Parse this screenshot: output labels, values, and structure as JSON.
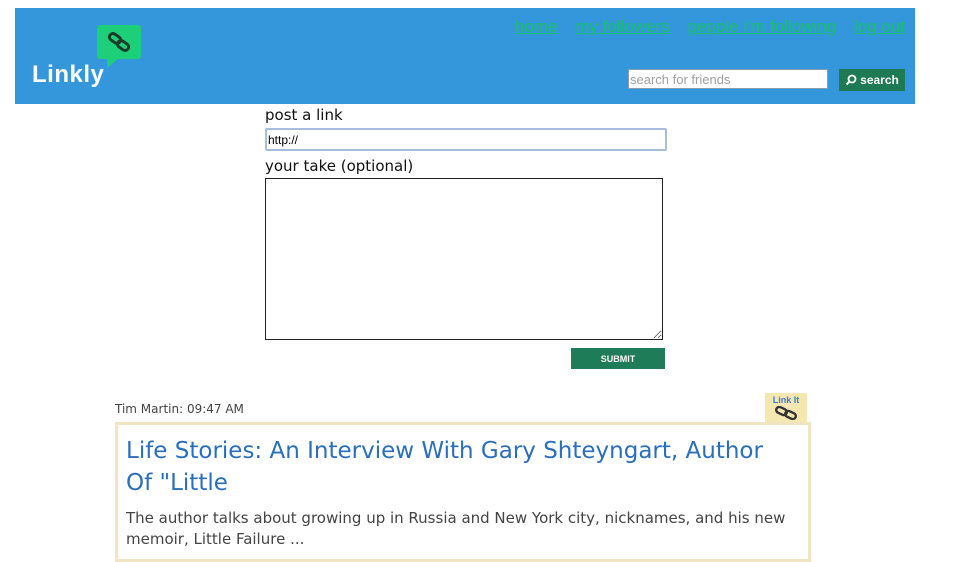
{
  "header": {
    "logo_text": "Linkly",
    "nav": {
      "home": "home",
      "followers": "my followers",
      "following": "people I'm following",
      "logout": "log out"
    },
    "search": {
      "placeholder": "search for friends",
      "button_label": "search"
    },
    "colors": {
      "bar": "#3497db",
      "accent": "#1ecf7a",
      "nav_link": "#17c06a"
    }
  },
  "post_form": {
    "link_label": "post a link",
    "link_value": "http://",
    "take_label": "your take (optional)",
    "take_value": "",
    "submit_label": "SUBMIT"
  },
  "feed": [
    {
      "meta": "Tim Martin: 09:47 AM",
      "link_it_label": "Link It",
      "title": "Life Stories: An Interview With Gary Shteyngart, Author Of \"Little",
      "description": "The author talks about growing up in Russia and New York city, nicknames, and his new memoir, Little Failure ..."
    }
  ]
}
